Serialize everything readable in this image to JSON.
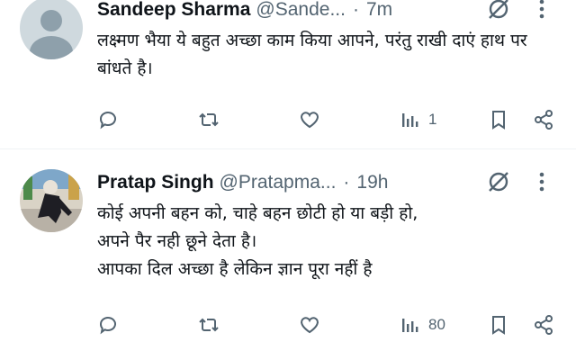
{
  "tweets": [
    {
      "author_name": "Sandeep Sharma",
      "handle": "@Sande...",
      "separator": "·",
      "time": "7m",
      "text": "लक्ष्मण भैया ये बहुत अच्छा काम किया आपने, परंतु राखी दाएं हाथ पर बांधते है।",
      "views_count": "1",
      "avatar": "default-avatar"
    },
    {
      "author_name": "Pratap Singh",
      "handle": "@Pratapma...",
      "separator": "·",
      "time": "19h",
      "text_lines": [
        "कोई अपनी बहन को, चाहे बहन छोटी हो या बड़ी हो,",
        "अपने पैर नही छूने देता है।",
        "आपका दिल अच्छा है लेकिन ज्ञान पूरा नहीं है"
      ],
      "views_count": "80",
      "avatar": "photo-avatar"
    }
  ],
  "icons": [
    "reply-icon",
    "repost-icon",
    "like-icon",
    "views-icon",
    "bookmark-icon",
    "share-icon",
    "grok-icon",
    "more-icon"
  ],
  "colors": {
    "text": "#0f1419",
    "secondary": "#536471",
    "divider": "#eff3f4"
  }
}
